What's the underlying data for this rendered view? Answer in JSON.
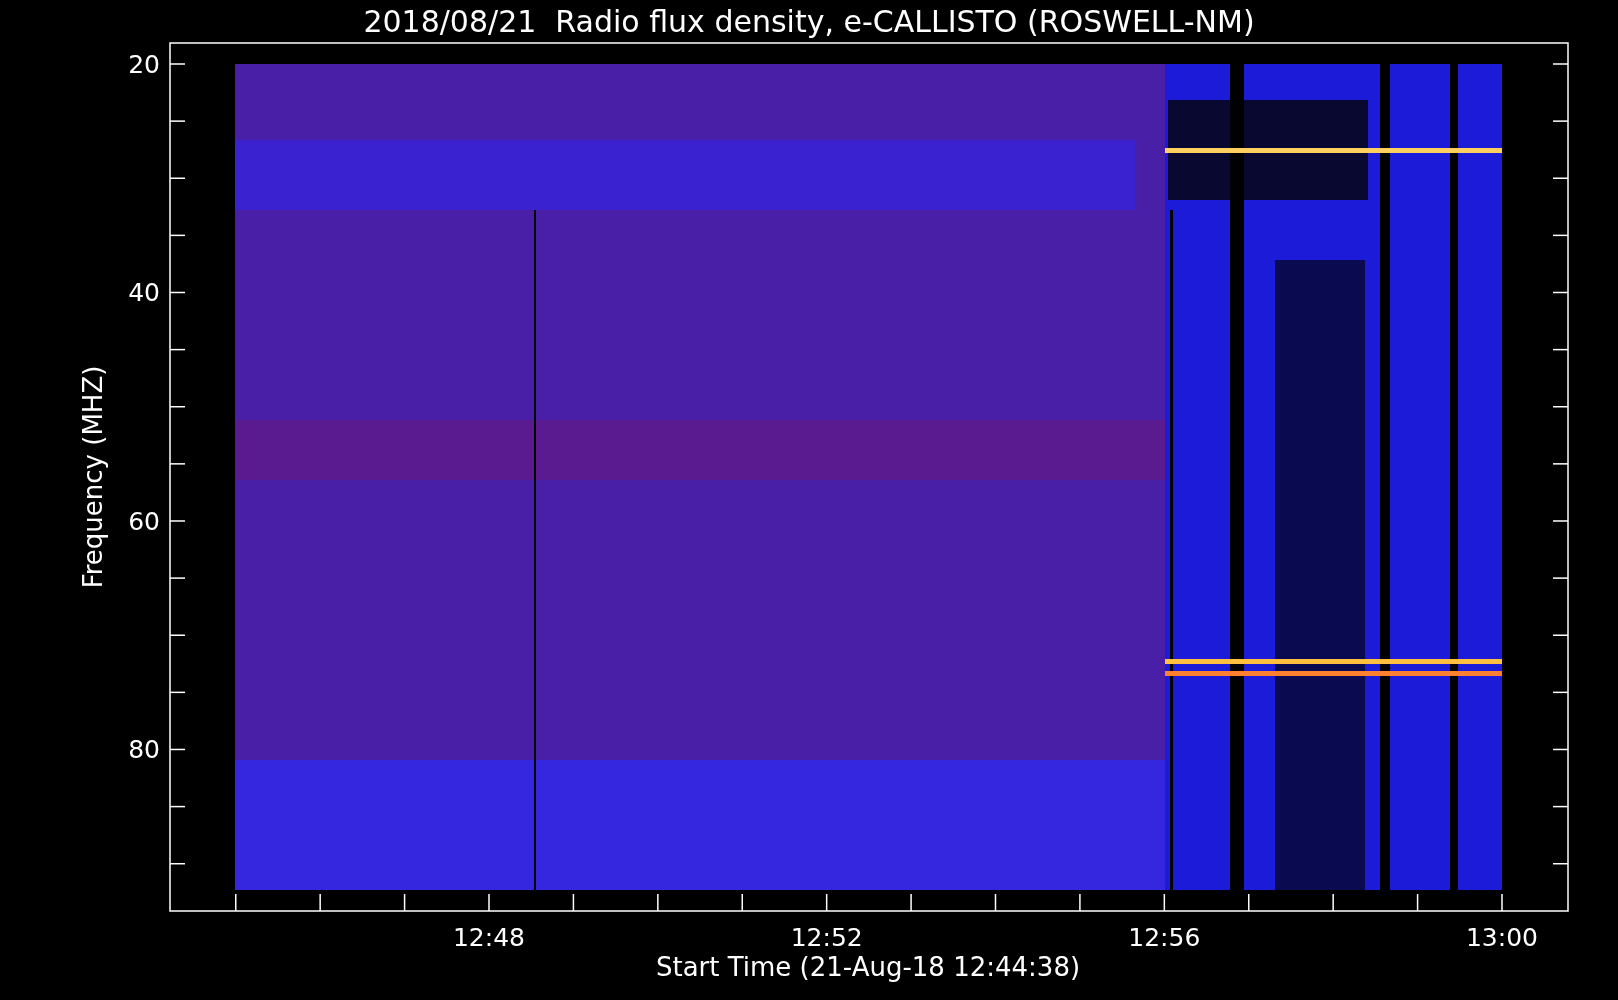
{
  "title": "2018/08/21  Radio flux density, e-CALLISTO (ROSWELL-NM)",
  "plot": {
    "ylabel": "Frequency (MHZ)",
    "xlabel": "Start Time (21-Aug-18 12:44:38)",
    "y_ticks": [
      "20",
      "40",
      "60",
      "80"
    ],
    "x_ticks": [
      "12:48",
      "12:52",
      "12:56",
      "13:00"
    ]
  }
}
